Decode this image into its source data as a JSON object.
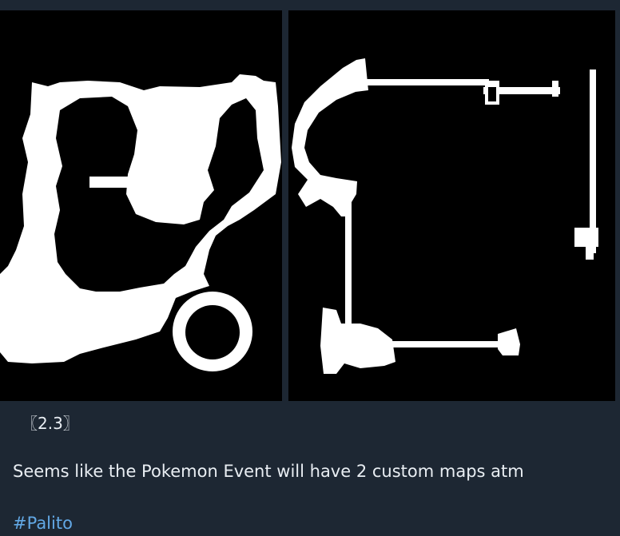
{
  "post": {
    "tag": "〖2.3〗",
    "text": "Seems like the Pokemon Event will have 2 custom maps atm",
    "hashtag": "#Palito"
  },
  "images": [
    {
      "name": "custom-map-1"
    },
    {
      "name": "custom-map-2"
    }
  ],
  "colors": {
    "background": "#1d2733",
    "text": "#e9eef3",
    "link": "#62a8e5"
  }
}
